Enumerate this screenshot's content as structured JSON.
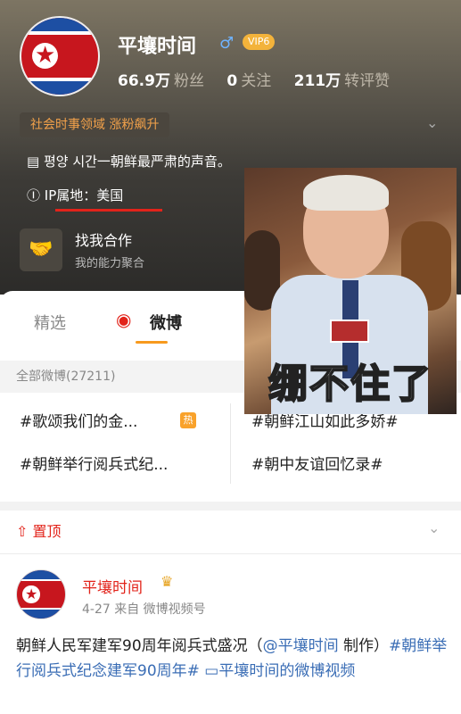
{
  "profile": {
    "name": "平壤时间",
    "gender_icon": "male-icon",
    "vip_badge": "VIP6",
    "followers_value": "66.9万",
    "followers_label": "粉丝",
    "following_value": "0",
    "following_label": "关注",
    "reposts_value": "211万",
    "reposts_label": "转评赞",
    "tag": "社会时事领域 涨粉飙升",
    "bio": "평양 시간一朝鲜最严肃的声音。",
    "ip": "IP属地：美国",
    "coop_title": "找我合作",
    "coop_sub": "我的能力聚合"
  },
  "tabs": {
    "featured": "精选",
    "weibo": "微博"
  },
  "summary": "全部微博(27211)",
  "topics": [
    "#歌颂我们的金...",
    "#朝鲜江山如此多娇#",
    "#朝鲜举行阅兵式纪...",
    "#朝中友谊回忆录#"
  ],
  "hot_badge": "热",
  "pinned_label": "置顶",
  "post": {
    "author": "平壤时间",
    "meta": "4-27  来自 微博视频号",
    "text_plain1": "朝鲜人民军建军90周年阅兵式盛况（",
    "text_mention": "@平壤时间",
    "text_plain2": " 制作）",
    "text_hashtag": "#朝鲜举行阅兵式纪念建军90周年#",
    "text_video": " ▭平壤时间的微博视频"
  },
  "meme": {
    "caption": "绷不住了"
  },
  "colors": {
    "accent_red": "#e2231a",
    "tag_orange": "#f2a14a",
    "link_blue": "#3a6db5",
    "tab_underline": "#f79a1e"
  }
}
